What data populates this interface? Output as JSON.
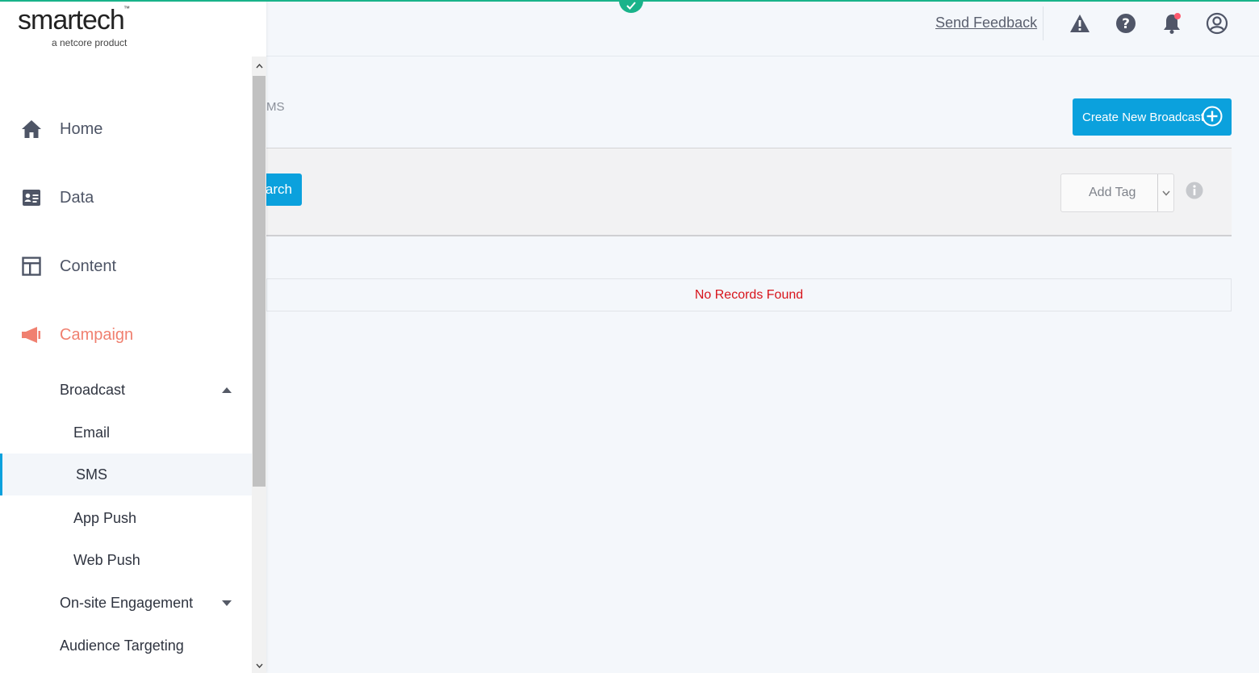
{
  "brand": {
    "name": "smartech",
    "tm": "™",
    "tagline": "a netcore product"
  },
  "header": {
    "send_feedback": "Send Feedback"
  },
  "header_icons": [
    "warning-icon",
    "help-icon",
    "bell-icon",
    "user-profile-icon"
  ],
  "page": {
    "breadcrumb_visible": "MS",
    "create_button": "Create New Broadcast",
    "search_button": "Search",
    "add_tag": "Add Tag",
    "empty_message": "No Records Found"
  },
  "sidebar": {
    "items": [
      {
        "label": "Home",
        "icon": "home-icon"
      },
      {
        "label": "Data",
        "icon": "contact-card-icon"
      },
      {
        "label": "Content",
        "icon": "layout-icon"
      },
      {
        "label": "Campaign",
        "icon": "megaphone-icon"
      }
    ],
    "campaign_children": [
      {
        "label": "Broadcast"
      },
      {
        "label": "Email"
      },
      {
        "label": "SMS"
      },
      {
        "label": "App Push"
      },
      {
        "label": "Web Push"
      },
      {
        "label": "On-site Engagement"
      },
      {
        "label": "Audience Targeting"
      }
    ]
  },
  "colors": {
    "accent": "#0ba1dd",
    "active_nav": "#f08070",
    "error": "#d7141b",
    "top_line": "#19b38a"
  }
}
